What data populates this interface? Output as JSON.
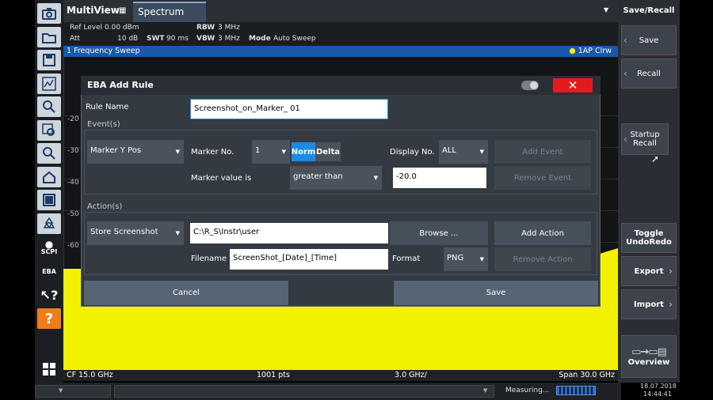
{
  "header": {
    "app_title": "MultiView",
    "tab_label": "Spectrum"
  },
  "settings": {
    "ref_level_label": "Ref Level",
    "ref_level_value": "0.00 dBm",
    "att_label": "Att",
    "att_value": "10 dB",
    "swt_label": "SWT",
    "swt_value": "90 ms",
    "rbw_label": "RBW",
    "rbw_value": "3 MHz",
    "vbw_label": "VBW",
    "vbw_value": "3 MHz",
    "mode_label": "Mode",
    "mode_value": "Auto Sweep"
  },
  "sweep": {
    "title": "1 Frequency Sweep",
    "indicator": "1AP Clrw"
  },
  "display": {
    "y_labels": [
      "-20",
      "-30",
      "-40",
      "-50",
      "-60"
    ]
  },
  "axis": {
    "cf": "CF 15.0 GHz",
    "points": "1001 pts",
    "div": "3.0 GHz/",
    "span": "Span 30.0 GHz"
  },
  "status": {
    "measuring": "Measuring...",
    "date": "18.07.2018",
    "time": "14:44:41"
  },
  "right_panel": {
    "title": "Save/Recall",
    "buttons": [
      "Save",
      "Recall",
      "Startup Recall",
      "Toggle UndoRedo",
      "Export",
      "Import",
      "Overview"
    ]
  },
  "left_toolbar": {
    "scpi": "SCPI",
    "eba": "EBA",
    "icons": [
      "camera-icon",
      "folder-open-icon",
      "save-icon",
      "print-icon",
      "zoom-icon",
      "zoom-area-icon",
      "zoom-magnifier-icon",
      "zoom-1-1-icon",
      "home-icon",
      "window-icon",
      "recycle-icon",
      "windows-icon"
    ]
  },
  "dialog": {
    "title": "EBA Add Rule",
    "rule_name_label": "Rule Name",
    "rule_name_value": "Screenshot_on_Marker_ 01",
    "events_group": "Event(s)",
    "event_type": "Marker Y Pos",
    "marker_no_label": "Marker No.",
    "marker_no_value": "1",
    "norm_label": "Norm",
    "delta_label": "Delta",
    "display_no_label": "Display No.",
    "display_no_value": "ALL",
    "add_event": "Add Event",
    "marker_value_label": "Marker value is",
    "comparison": "greater than",
    "threshold": "-20.0",
    "remove_event": "Remove Event",
    "actions_group": "Action(s)",
    "action_type": "Store Screenshot",
    "path": "C:\\R_S\\Instr\\user",
    "browse": "Browse ...",
    "add_action": "Add Action",
    "filename_label": "Filename",
    "filename_value": "ScreenShot_[Date]_[Time]",
    "format_label": "Format",
    "format_value": "PNG",
    "remove_action": "Remove Action",
    "cancel": "Cancel",
    "save": "Save"
  },
  "colors": {
    "trace": "#f2f200",
    "accent": "#1a8ce8",
    "close": "#e21b1b",
    "sweep_bar": "#1a58a8"
  }
}
